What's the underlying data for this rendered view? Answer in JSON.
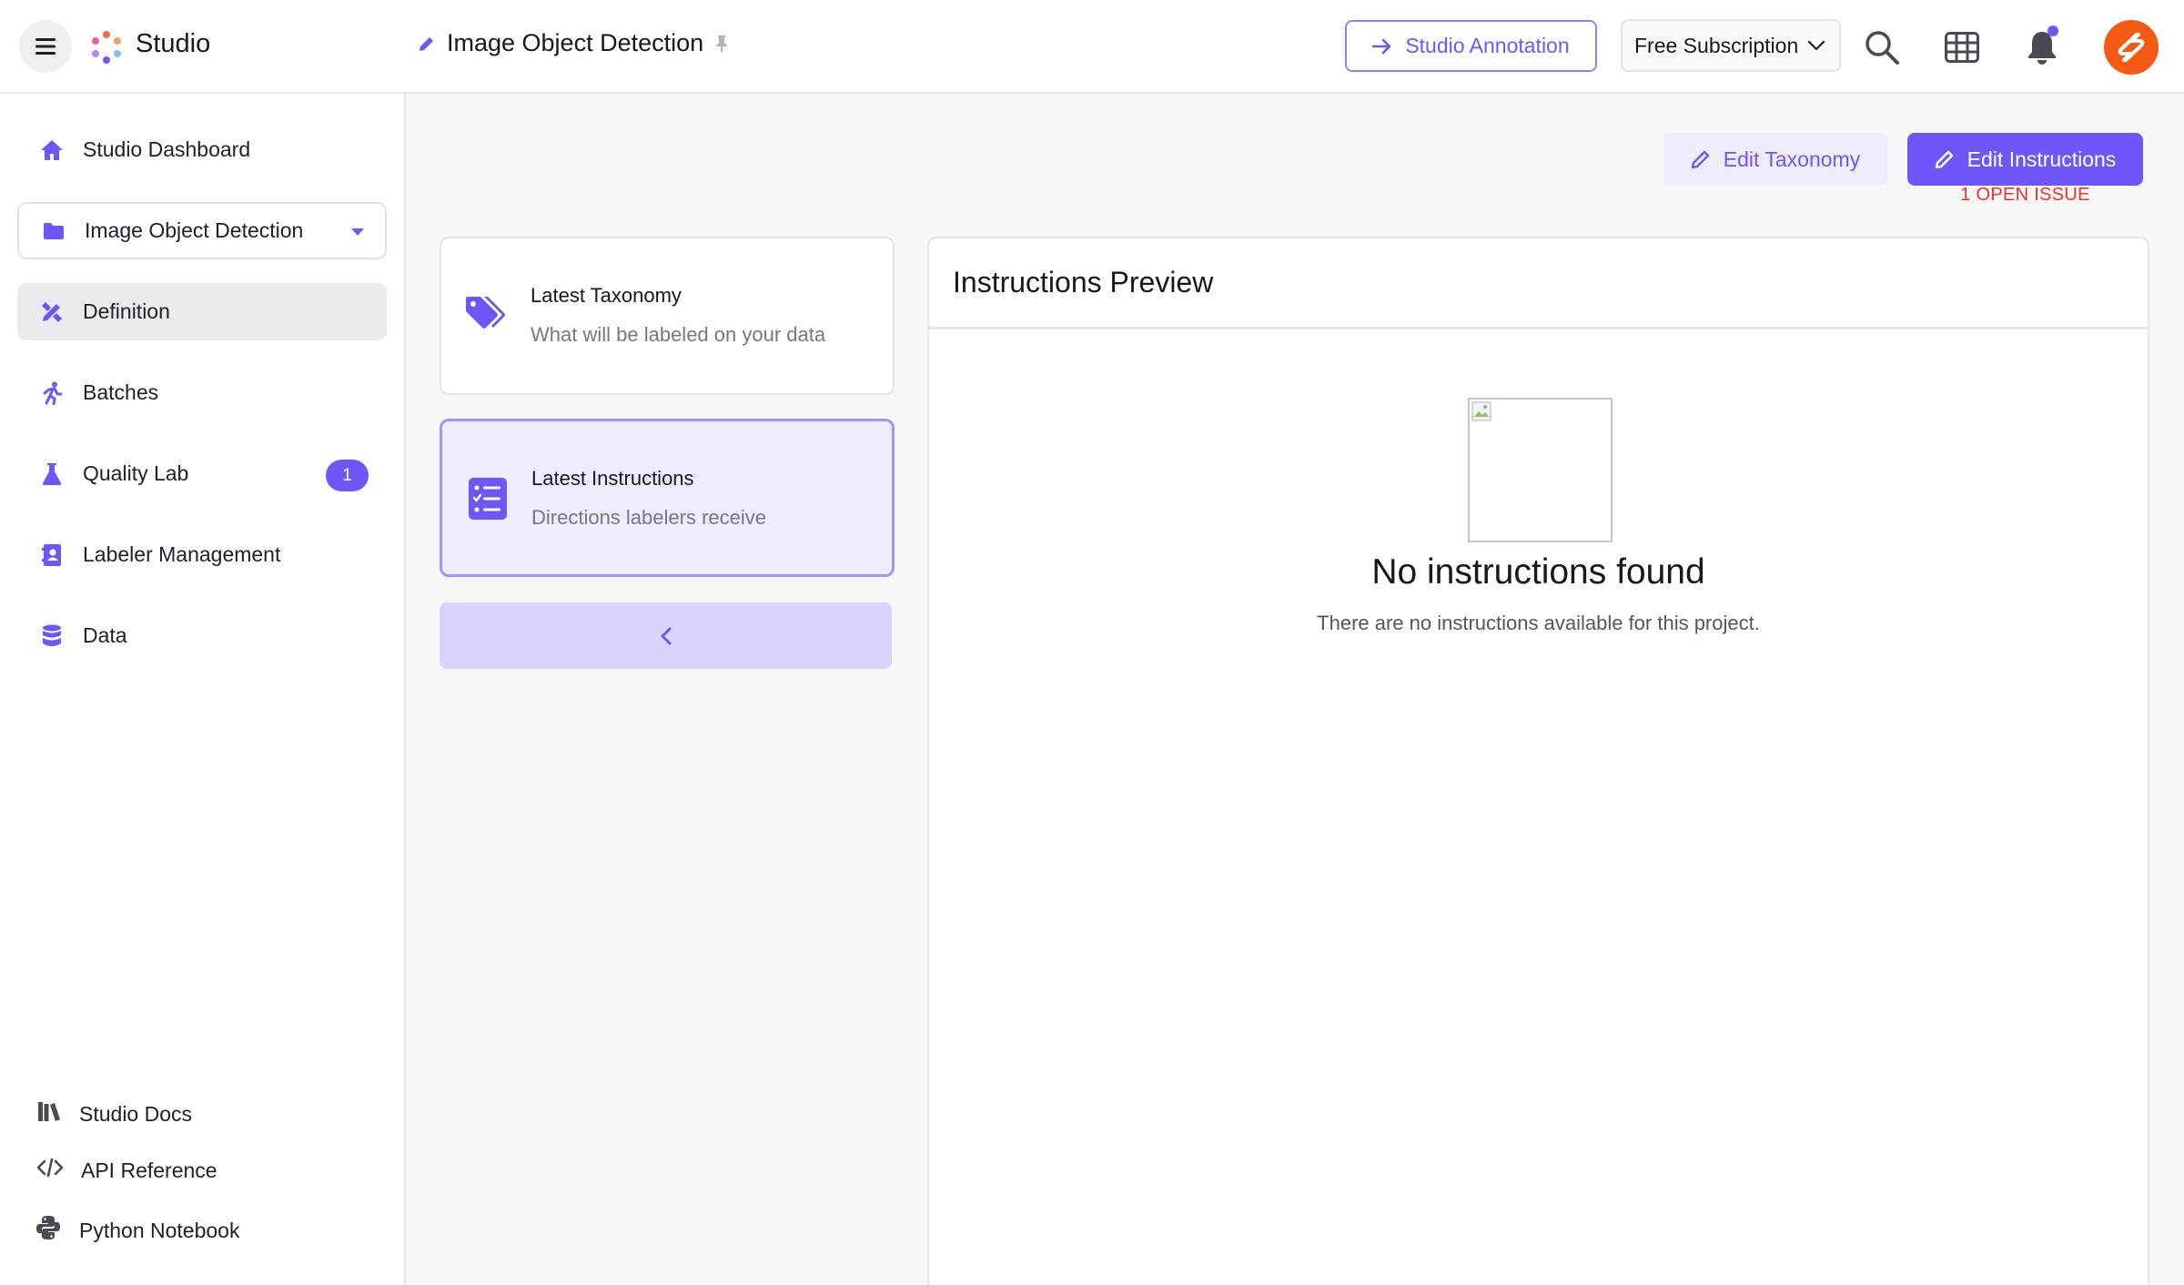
{
  "header": {
    "app_title": "Studio",
    "project_title": "Image Object Detection",
    "studio_annotation_label": "Studio Annotation",
    "subscription_label": "Free Subscription"
  },
  "sidebar": {
    "items": [
      {
        "label": "Studio Dashboard",
        "icon": "home-icon"
      },
      {
        "label": "Image Object Detection",
        "icon": "folder-icon"
      },
      {
        "label": "Definition",
        "icon": "pencil-ruler-icon"
      },
      {
        "label": "Batches",
        "icon": "runner-icon"
      },
      {
        "label": "Quality Lab",
        "icon": "flask-icon",
        "badge": "1"
      },
      {
        "label": "Labeler Management",
        "icon": "contact-book-icon"
      },
      {
        "label": "Data",
        "icon": "database-icon"
      }
    ],
    "footer": [
      {
        "label": "Studio Docs",
        "icon": "books-icon"
      },
      {
        "label": "API Reference",
        "icon": "code-icon"
      },
      {
        "label": "Python Notebook",
        "icon": "python-icon"
      }
    ]
  },
  "actions": {
    "edit_taxonomy": "Edit Taxonomy",
    "edit_instructions": "Edit Instructions",
    "open_issue": "1 OPEN ISSUE"
  },
  "cards": [
    {
      "title": "Latest Taxonomy",
      "subtitle": "What will be labeled on your data",
      "icon": "tags-icon"
    },
    {
      "title": "Latest Instructions",
      "subtitle": "Directions labelers receive",
      "icon": "checklist-icon",
      "selected": true
    }
  ],
  "preview": {
    "title": "Instructions Preview",
    "empty_title": "No instructions found",
    "empty_subtitle": "There are no instructions available for this project."
  },
  "colors": {
    "accent": "#6e56f8",
    "accent_light": "#efedfd",
    "issue_red": "#e8352b",
    "avatar": "#f45a14"
  }
}
